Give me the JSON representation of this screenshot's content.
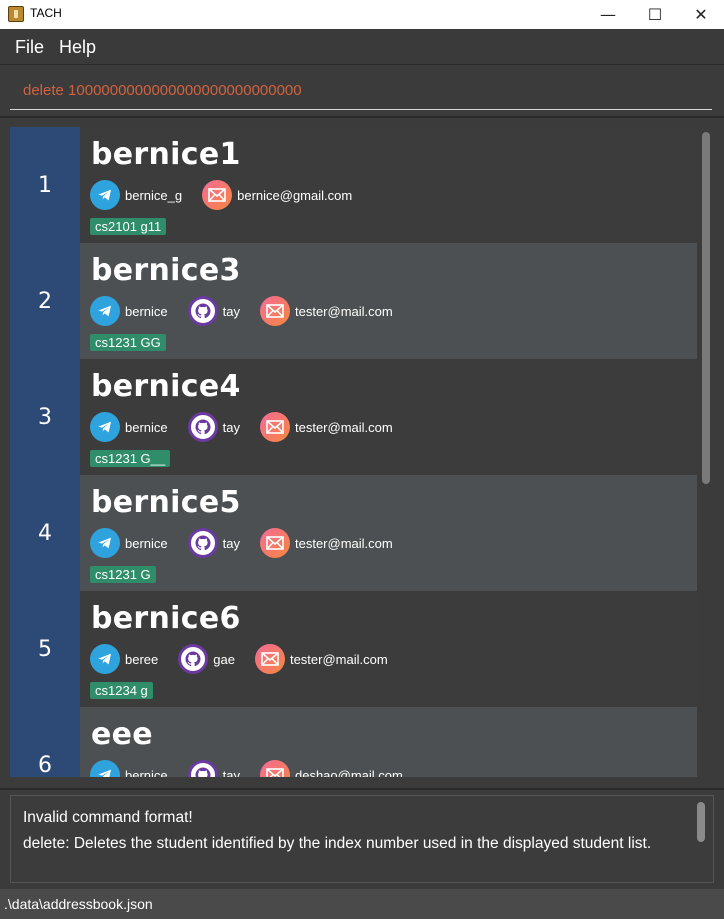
{
  "window": {
    "title": "TACH"
  },
  "menu": {
    "file": "File",
    "help": "Help"
  },
  "command": {
    "value": "delete 1000000000000000000000000000"
  },
  "persons": [
    {
      "index": "1",
      "name": "bernice1",
      "telegram": "bernice_g",
      "github": null,
      "email": "bernice@gmail.com",
      "tag": "cs2101 g11"
    },
    {
      "index": "2",
      "name": "bernice3",
      "telegram": "bernice",
      "github": "tay",
      "email": "tester@mail.com",
      "tag": "cs1231 GG"
    },
    {
      "index": "3",
      "name": "bernice4",
      "telegram": "bernice",
      "github": "tay",
      "email": "tester@mail.com",
      "tag": "cs1231 G__"
    },
    {
      "index": "4",
      "name": "bernice5",
      "telegram": "bernice",
      "github": "tay",
      "email": "tester@mail.com",
      "tag": "cs1231 G"
    },
    {
      "index": "5",
      "name": "bernice6",
      "telegram": "beree",
      "github": "gae",
      "email": "tester@mail.com",
      "tag": "cs1234 g"
    },
    {
      "index": "6",
      "name": "eee",
      "telegram": "bernice",
      "github": "tay",
      "email": "deshao@mail.com",
      "tag": ""
    }
  ],
  "result": {
    "line1": "Invalid command format!",
    "line2": "delete: Deletes the student identified by the index number used in the displayed student list."
  },
  "status": {
    "path": ".\\data\\addressbook.json"
  },
  "colors": {
    "index_bg": "#2d4a77",
    "tag_bg": "#2f8d6a",
    "command_text": "#d2623f",
    "telegram": "#2ea3dd",
    "github_ring": "#6a3aa0"
  }
}
